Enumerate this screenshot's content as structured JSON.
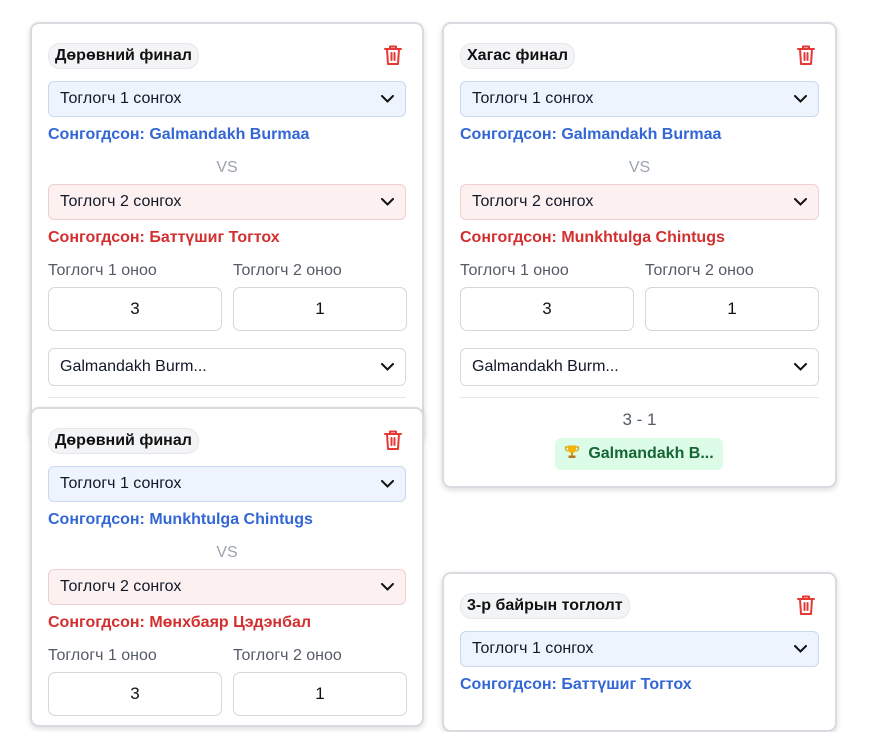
{
  "colors": {
    "p1_select_bg": "#eef4fd",
    "p2_select_bg": "#fdf0f0",
    "chosen_p1": "#3367d6",
    "chosen_p2": "#d32f2f",
    "winner_bg": "#dcfce7",
    "winner_text": "#166534",
    "trash_icon": "#e53935"
  },
  "matches": [
    {
      "stage": "Дөрөвний финал",
      "p1_select": "Тоглогч 1 сонгох",
      "p1_chosen": "Сонгогдсон: Galmandakh Burmaa",
      "vs": "VS",
      "p2_select": "Тоглогч 2 сонгох",
      "p2_chosen": "Сонгогдсон: Баттүшиг Тогтох",
      "score1_label": "Тоглогч 1 оноо",
      "score2_label": "Тоглогч 2 оноо",
      "score1": "3",
      "score2": "1",
      "winner_select": "Galmandakh Burm..."
    },
    {
      "stage": "Хагас финал",
      "p1_select": "Тоглогч 1 сонгох",
      "p1_chosen": "Сонгогдсон: Galmandakh Burmaa",
      "vs": "VS",
      "p2_select": "Тоглогч 2 сонгох",
      "p2_chosen": "Сонгогдсон: Munkhtulga Chintugs",
      "score1_label": "Тоглогч 1 оноо",
      "score2_label": "Тоглогч 2 оноо",
      "score1": "3",
      "score2": "1",
      "winner_select": "Galmandakh Burm...",
      "result": "3 - 1",
      "winner_badge": "Galmandakh B..."
    },
    {
      "stage": "Дөрөвний финал",
      "p1_select": "Тоглогч 1 сонгох",
      "p1_chosen": "Сонгогдсон: Munkhtulga Chintugs",
      "vs": "VS",
      "p2_select": "Тоглогч 2 сонгох",
      "p2_chosen": "Сонгогдсон: Мөнхбаяр Цэдэнбал",
      "score1_label": "Тоглогч 1 оноо",
      "score2_label": "Тоглогч 2 оноо",
      "score1": "3",
      "score2": "1"
    },
    {
      "stage": "3-р байрын тоглолт",
      "p1_select": "Тоглогч 1 сонгох",
      "p1_chosen": "Сонгогдсон: Баттүшиг Тогтох"
    }
  ]
}
